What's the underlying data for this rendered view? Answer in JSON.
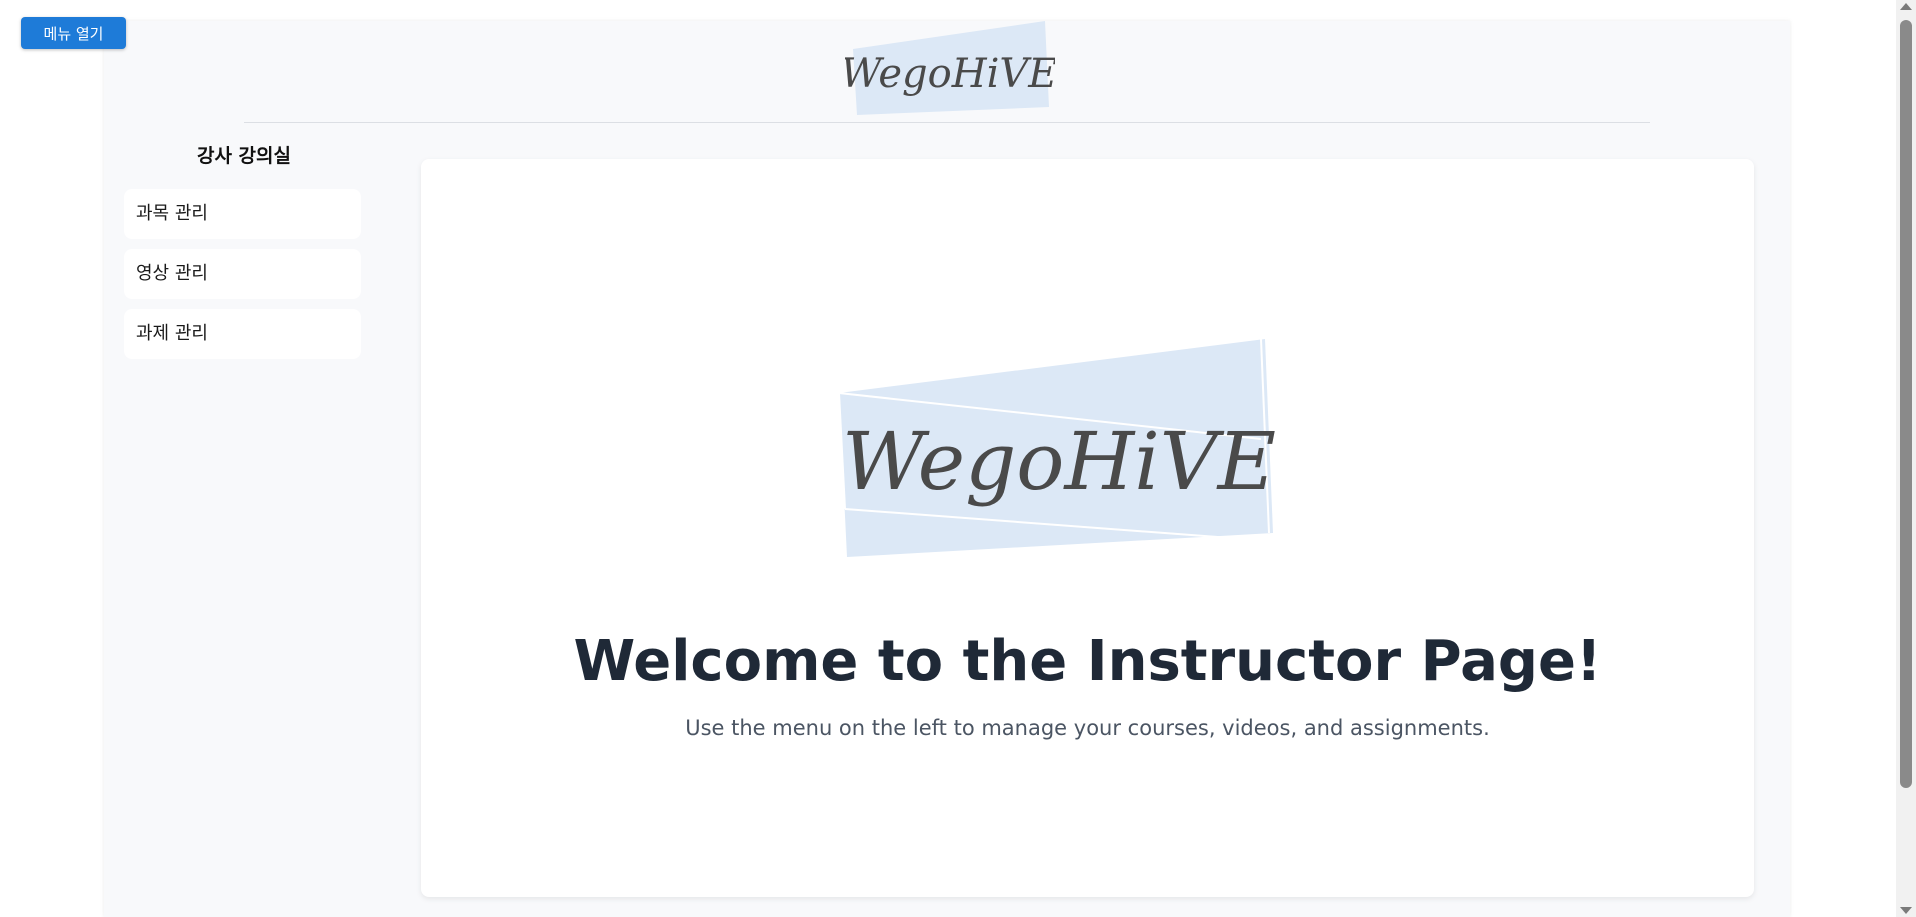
{
  "menu_button": {
    "label": "메뉴 열기"
  },
  "header": {
    "logo_text": "WegoHiVE"
  },
  "sidebar": {
    "title": "강사 강의실",
    "items": [
      {
        "label": "과목 관리"
      },
      {
        "label": "영상 관리"
      },
      {
        "label": "과제 관리"
      }
    ]
  },
  "main": {
    "logo_text": "WegoHiVE",
    "heading": "Welcome to the Instructor Page!",
    "subtitle": "Use the menu on the left to manage your courses, videos, and assignments."
  },
  "colors": {
    "accent": "#1e7bd8",
    "logo_background": "#dce8f6",
    "logo_text": "#4a4a4a",
    "heading": "#1f2937"
  }
}
